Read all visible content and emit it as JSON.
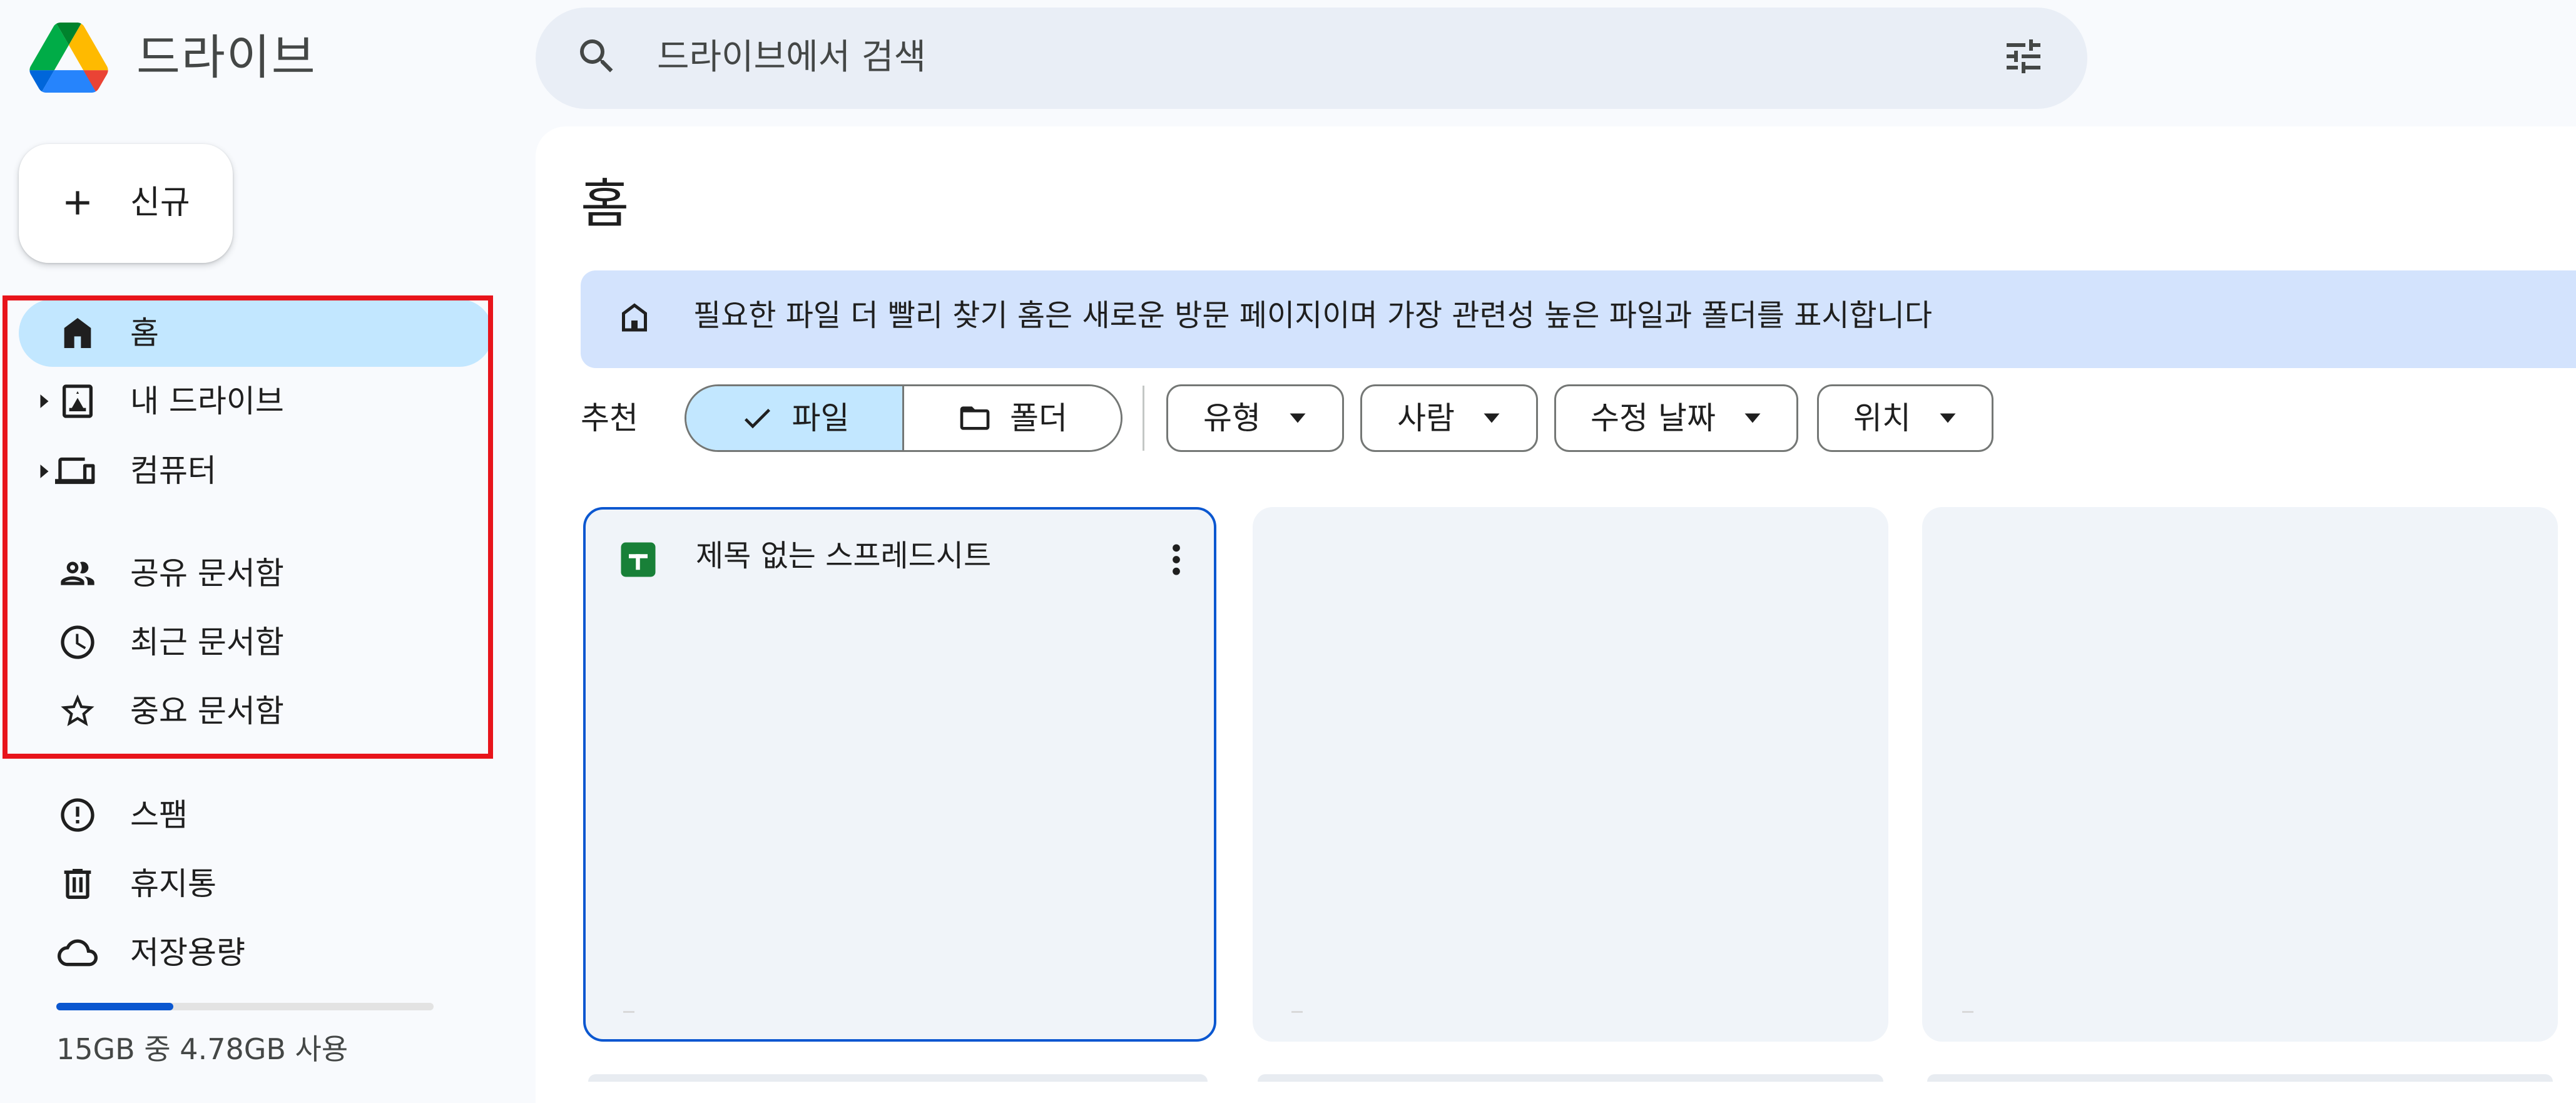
{
  "app": {
    "title": "드라이브",
    "logo_icon": "google-drive-logo"
  },
  "search": {
    "placeholder": "드라이브에서 검색",
    "icon": "search-icon",
    "filter_icon": "tune-icon"
  },
  "new_button": {
    "label": "신규",
    "icon": "plus-icon"
  },
  "sidebar": {
    "items": [
      {
        "label": "홈",
        "icon": "home-icon",
        "selected": true
      },
      {
        "label": "내 드라이브",
        "icon": "my-drive-icon",
        "expandable": true
      },
      {
        "label": "컴퓨터",
        "icon": "computers-icon",
        "expandable": true
      },
      {
        "label": "공유 문서함",
        "icon": "shared-icon"
      },
      {
        "label": "최근 문서함",
        "icon": "clock-icon"
      },
      {
        "label": "중요 문서함",
        "icon": "star-icon"
      },
      {
        "label": "스팸",
        "icon": "spam-icon"
      },
      {
        "label": "휴지통",
        "icon": "trash-icon"
      },
      {
        "label": "저장용량",
        "icon": "cloud-icon"
      }
    ],
    "storage": {
      "text": "15GB 중 4.78GB 사용",
      "used_fraction": 0.31
    }
  },
  "main": {
    "title": "홈",
    "banner": {
      "text": "필요한 파일 더 빨리 찾기  홈은 새로운 방문 페이지이며 가장 관련성 높은 파일과 폴더를 표시합니다"
    },
    "suggested_label": "추천",
    "toggle": {
      "files_label": "파일",
      "folders_label": "폴더",
      "selected": "files"
    },
    "filters": [
      {
        "label": "유형"
      },
      {
        "label": "사람"
      },
      {
        "label": "수정 날짜"
      },
      {
        "label": "위치"
      }
    ],
    "cards": [
      {
        "title": "제목 없는 스프레드시트",
        "icon": "google-sheets-icon",
        "selected": true
      }
    ]
  },
  "colors": {
    "accent": "#0b57d0",
    "selection": "#c2e7ff",
    "banner": "#d3e3fd",
    "highlight_box": "#e8141b",
    "background": "#f8fafd"
  }
}
